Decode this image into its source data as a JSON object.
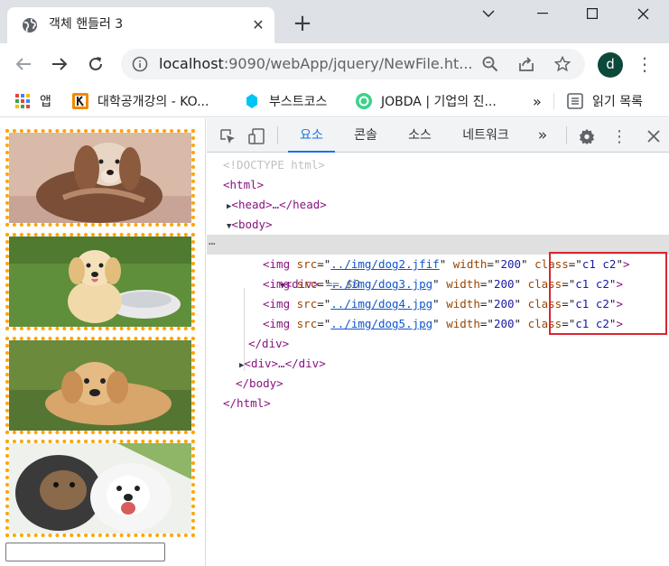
{
  "browser": {
    "tab_title": "객체 핸들러 3",
    "tab_close": "✕",
    "new_tab": "+",
    "url_host": "localhost",
    "url_rest": ":9090/webApp/jquery/NewFile.ht...",
    "profile_initial": "d"
  },
  "bookmarks": [
    {
      "label": "앱",
      "icon": "apps-grid-icon"
    },
    {
      "label": "대학공개강의 - KO...",
      "icon": "kocw-icon"
    },
    {
      "label": "부스트코스",
      "icon": "boostcourse-icon"
    },
    {
      "label": "JOBDA | 기업의 진...",
      "icon": "jobda-icon"
    },
    {
      "label": "»",
      "icon": ""
    },
    {
      "label": "읽기 목록",
      "icon": "reading-list-icon"
    }
  ],
  "colors": {
    "dotted_border": "#ffa500",
    "highlight_box": "#d9262f",
    "active_tab": "#1a73e8",
    "tag": "#881280",
    "attr": "#994500",
    "val": "#1a1aa6"
  },
  "devtools": {
    "tabs": [
      "요소",
      "콘솔",
      "소스",
      "네트워크"
    ],
    "more": "»",
    "dom": {
      "doctype": "<!DOCTYPE html>",
      "html_open": "<html>",
      "head": "<head>…</head>",
      "body_open": "<body>",
      "div_open": "<div>",
      "div_eq": "== $0",
      "imgs": [
        {
          "src": "../img/dog2.jfif",
          "width": "200",
          "class": "c1 c2"
        },
        {
          "src": "../img/dog3.jpg",
          "width": "200",
          "class": "c1 c2"
        },
        {
          "src": "../img/dog4.jpg",
          "width": "200",
          "class": "c1 c2"
        },
        {
          "src": "../img/dog5.jpg",
          "width": "200",
          "class": "c1 c2"
        }
      ],
      "div_close": "</div>",
      "div_collapsed": "<div>…</div>",
      "body_close": "</body>",
      "html_close": "</html>"
    }
  }
}
